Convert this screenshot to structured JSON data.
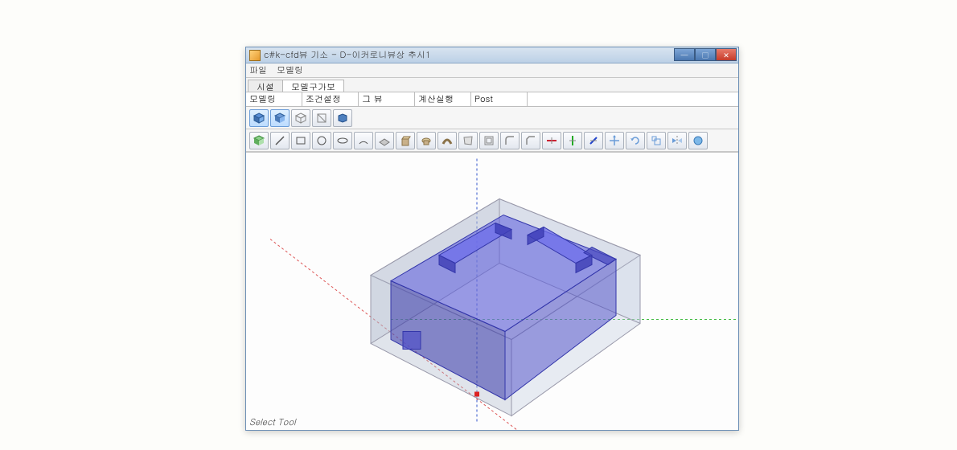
{
  "window": {
    "title": "c#k-cfd뷰 기소 - D-이커로니뷰상 추시1"
  },
  "menu": {
    "file": "파일",
    "modeling": "모델링"
  },
  "tabs": {
    "tab1": "시설",
    "tab2": "모델구가보"
  },
  "subtabs": {
    "t1": "모델링",
    "t2": "조건설정",
    "t3": "그 뷰",
    "t4": "계산실행",
    "t5": "Post"
  },
  "status": {
    "text": "Select Tool"
  },
  "icons": {
    "toolbar1": [
      "view-iso-icon",
      "view-shaded-icon",
      "view-wire-icon",
      "view-hidden-icon",
      "view-box-icon"
    ],
    "toolbar2": [
      "cube-icon",
      "line-icon",
      "rect-icon",
      "circle-icon",
      "ellipse-icon",
      "arc-icon",
      "surface-icon",
      "extrude-icon",
      "revolve-icon",
      "sweep-icon",
      "loft-icon",
      "shell-icon",
      "fillet-icon",
      "chamfer-icon",
      "axis-x-icon",
      "axis-y-icon",
      "axis-z-icon",
      "move-icon",
      "rotate-icon",
      "scale-icon",
      "mirror-icon",
      "render-icon"
    ]
  }
}
